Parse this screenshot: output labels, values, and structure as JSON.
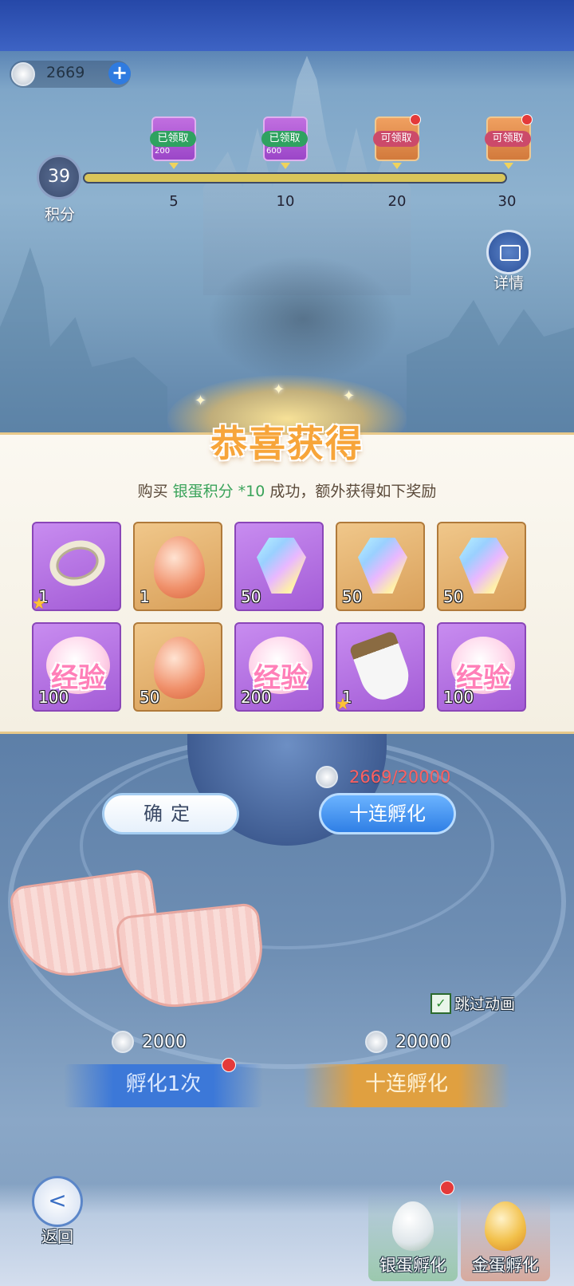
{
  "currency": {
    "icon": "silver-coin-icon",
    "amount": "2669"
  },
  "progress": {
    "points": "39",
    "points_label": "积分",
    "fill_fraction": 1.0,
    "milestones": [
      {
        "threshold": "5",
        "reward": "200",
        "status": "已领取"
      },
      {
        "threshold": "10",
        "reward": "600",
        "status": "已领取"
      },
      {
        "threshold": "20",
        "reward": "",
        "status": "可领取"
      },
      {
        "threshold": "30",
        "reward": "",
        "status": "可领取"
      }
    ]
  },
  "detail_label": "详情",
  "popup": {
    "title": "恭喜获得",
    "msg_prefix": "购买 ",
    "msg_highlight": "银蛋积分 *10",
    "msg_suffix": " 成功，额外获得如下奖励",
    "items": [
      {
        "type": "ring",
        "quantity": "1",
        "rarity": "purple",
        "star": true
      },
      {
        "type": "peach-egg",
        "quantity": "1",
        "rarity": "orange",
        "star": false
      },
      {
        "type": "gem",
        "quantity": "50",
        "rarity": "purple",
        "star": false
      },
      {
        "type": "gem",
        "quantity": "50",
        "rarity": "orange",
        "star": false
      },
      {
        "type": "gem",
        "quantity": "50",
        "rarity": "orange",
        "star": false
      },
      {
        "type": "exp",
        "quantity": "100",
        "rarity": "purple",
        "star": false,
        "label": "经验"
      },
      {
        "type": "peach-egg",
        "quantity": "50",
        "rarity": "orange",
        "star": false
      },
      {
        "type": "exp",
        "quantity": "200",
        "rarity": "purple",
        "star": false,
        "label": "经验"
      },
      {
        "type": "glove",
        "quantity": "1",
        "rarity": "purple",
        "star": true
      },
      {
        "type": "exp",
        "quantity": "100",
        "rarity": "purple",
        "star": false,
        "label": "经验"
      }
    ],
    "confirm_label": "确定",
    "ten_hatch_label": "十连孵化",
    "cost_display": "2669/20000"
  },
  "skip_animation_label": "跳过动画",
  "hatch": {
    "single": {
      "price": "2000",
      "label": "孵化1次"
    },
    "ten": {
      "price": "20000",
      "label": "十连孵化"
    }
  },
  "nav": {
    "back_label": "返回",
    "silver_tab": "银蛋孵化",
    "gold_tab": "金蛋孵化"
  },
  "colors": {
    "accent_green": "#3aa35a",
    "title_orange": "#f7a53a",
    "cost_red": "#ff6060"
  }
}
